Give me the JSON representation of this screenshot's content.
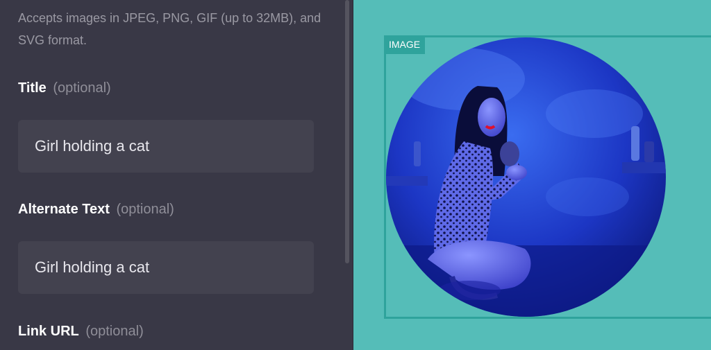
{
  "panel": {
    "helper_text": "Accepts images in JPEG, PNG, GIF (up to 32MB), and SVG format.",
    "title_label": "Title",
    "title_optional": "(optional)",
    "title_value": "Girl holding a cat",
    "alt_label": "Alternate Text",
    "alt_optional": "(optional)",
    "alt_value": "Girl holding a cat",
    "link_label": "Link URL",
    "link_optional": "(optional)"
  },
  "preview": {
    "block_tag": "IMAGE",
    "image_description_icon": "photo-circle-crop"
  },
  "colors": {
    "panel_bg": "#393846",
    "field_bg": "#43424f",
    "canvas_bg": "#55bdb8",
    "selection_accent": "#2fa39c",
    "photo_blue": "#1e3fd0"
  }
}
